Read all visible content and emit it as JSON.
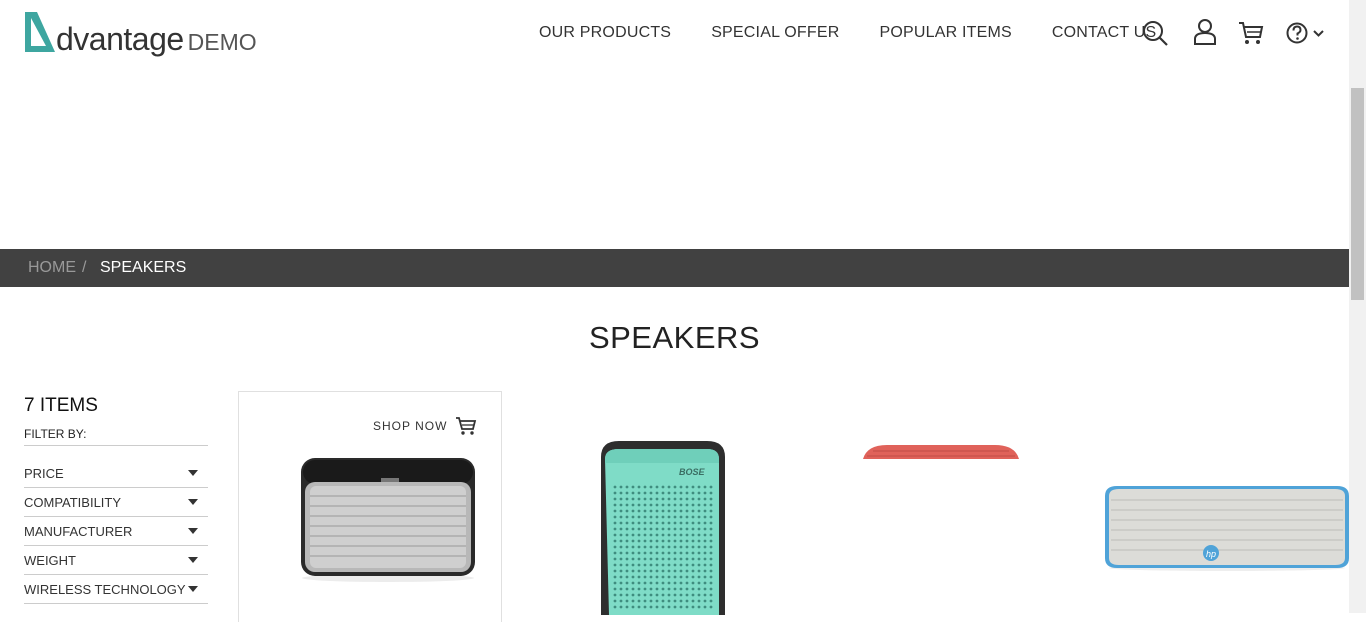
{
  "logo": {
    "brand": "dvantage",
    "suffix": "DEMO",
    "accent": "#3ea6a0"
  },
  "nav": {
    "items": [
      "OUR PRODUCTS",
      "SPECIAL OFFER",
      "POPULAR ITEMS",
      "CONTACT US"
    ]
  },
  "icons": [
    "search-icon",
    "user-icon",
    "cart-icon",
    "help-icon",
    "chevron-down-icon"
  ],
  "breadcrumb": {
    "home": "HOME",
    "separator": "/",
    "current": "SPEAKERS"
  },
  "page": {
    "title": "SPEAKERS"
  },
  "filter": {
    "count": "7 ITEMS",
    "label": "FILTER BY:",
    "items": [
      "PRICE",
      "COMPATIBILITY",
      "MANUFACTURER",
      "WEIGHT",
      "WIRELESS TECHNOLOGY"
    ]
  },
  "products": {
    "shop_now": "SHOP NOW"
  },
  "colors": {
    "breadcrumb_bg": "#414141",
    "speaker_teal": "#7fdcc7",
    "speaker_red": "#e0625a",
    "speaker_blue": "#4fa3d8"
  }
}
